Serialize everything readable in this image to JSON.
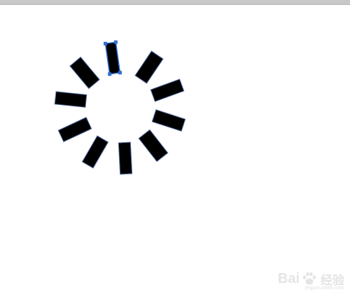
{
  "canvas": {
    "background": "#ffffff",
    "bar_fill": "#000000",
    "bar_outline": "#5b74a8",
    "selection_color": "#2f6fd0"
  },
  "spinner": {
    "bar_count": 10,
    "selected_bar_index": 0
  },
  "watermark": {
    "brand_left": "Bai",
    "brand_icon": "paw-icon",
    "brand_right": "经验",
    "domain": "jingyan.baidu.com"
  }
}
